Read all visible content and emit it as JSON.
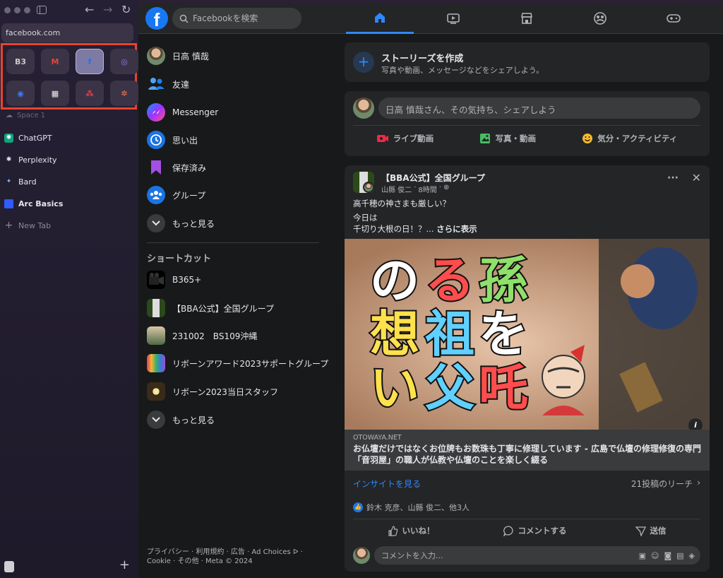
{
  "browser": {
    "url": "facebook.com",
    "pinned_tabs": [
      {
        "icon": "box-icon",
        "glyph": "B3",
        "color": "#c9c9c9",
        "active": false
      },
      {
        "icon": "gmail-icon",
        "glyph": "M",
        "color": "#ea4335",
        "active": false
      },
      {
        "icon": "facebook-icon",
        "glyph": "f",
        "color": "#1877f2",
        "active": true
      },
      {
        "icon": "messenger-icon",
        "glyph": "◎",
        "color": "#8b7bff",
        "active": false
      },
      {
        "icon": "messenger-blue-icon",
        "glyph": "◉",
        "color": "#3b7cff",
        "active": false
      },
      {
        "icon": "calendar-icon",
        "glyph": "▦",
        "color": "#f0f0f0",
        "active": false
      },
      {
        "icon": "dots-icon",
        "glyph": "⁂",
        "color": "#e8434a",
        "active": false
      },
      {
        "icon": "hubspot-icon",
        "glyph": "✲",
        "color": "#ff7a59",
        "active": false
      }
    ],
    "space_label": "Space 1",
    "tabs": [
      {
        "label": "ChatGPT",
        "icon": "chatgpt-icon",
        "bold": false
      },
      {
        "label": "Perplexity",
        "icon": "perplexity-icon",
        "bold": false
      },
      {
        "label": "Bard",
        "icon": "bard-icon",
        "bold": false
      },
      {
        "label": "Arc Basics",
        "icon": "folder-icon",
        "bold": true
      }
    ],
    "new_tab": "New Tab"
  },
  "fb": {
    "logo": "f",
    "search_placeholder": "Facebookを検索",
    "nav": [
      "home-icon",
      "video-icon",
      "marketplace-icon",
      "groups-icon",
      "gaming-icon"
    ],
    "left_menu": [
      {
        "label": "日高 慎哉",
        "icon": "profile-avatar"
      },
      {
        "label": "友達",
        "icon": "friends-icon"
      },
      {
        "label": "Messenger",
        "icon": "messenger-icon"
      },
      {
        "label": "思い出",
        "icon": "memories-icon"
      },
      {
        "label": "保存済み",
        "icon": "saved-icon"
      },
      {
        "label": "グループ",
        "icon": "groups-icon"
      },
      {
        "label": "もっと見る",
        "icon": "chevron-down-icon"
      }
    ],
    "shortcuts_heading": "ショートカット",
    "shortcuts": [
      {
        "label": "B365+",
        "icon": "b365-thumb"
      },
      {
        "label": "【BBA公式】全国グループ",
        "icon": "bba-thumb"
      },
      {
        "label": "231002　BS109沖縄",
        "icon": "okinawa-thumb"
      },
      {
        "label": "リボーンアワード2023サポートグループ",
        "icon": "reborn-award-thumb"
      },
      {
        "label": "リボーン2023当日スタッフ",
        "icon": "reborn-staff-thumb"
      },
      {
        "label": "もっと見る",
        "icon": "chevron-down-icon"
      }
    ],
    "footer": "プライバシー · 利用規約 · 広告 · Ad Choices ᐅ · Cookie · その他 · Meta © 2024",
    "story": {
      "title": "ストーリーズを作成",
      "subtitle": "写真や動画、メッセージなどをシェアしよう。"
    },
    "composer": {
      "placeholder": "日高 慎哉さん、その気持ち、シェアしよう",
      "actions": [
        {
          "label": "ライブ動画",
          "icon": "live-video-icon",
          "color": "#f02849"
        },
        {
          "label": "写真・動画",
          "icon": "photo-icon",
          "color": "#45bd62"
        },
        {
          "label": "気分・アクティビティ",
          "icon": "feeling-icon",
          "color": "#f7b928"
        }
      ]
    },
    "post": {
      "group": "【BBA公式】全国グループ",
      "author": "山縣 俊二",
      "time": "8時間",
      "line1": "高千穂の神さまも厳しい？",
      "line2": "今日は",
      "line3": "千切り大根の日！？...",
      "see_more": "さらに表示",
      "image_text": [
        "の",
        "る",
        "孫",
        "想",
        "祖",
        "を",
        "い",
        "父",
        "吒"
      ],
      "link_domain": "OTOWAYA.NET",
      "link_title": "お仏壇だけではなくお位牌もお数珠も丁寧に修理しています - 広島で仏壇の修理修復の専門「音羽屋」の職人が仏教や仏壇のことを楽しく綴る",
      "insights": "インサイトを見る",
      "reach": "21投稿のリーチ",
      "reactions": "鈴木 克彦、山縣 俊二、他3人",
      "like": "いいね！",
      "comment": "コメントする",
      "send": "送信",
      "comment_placeholder": "コメントを入力..."
    }
  }
}
